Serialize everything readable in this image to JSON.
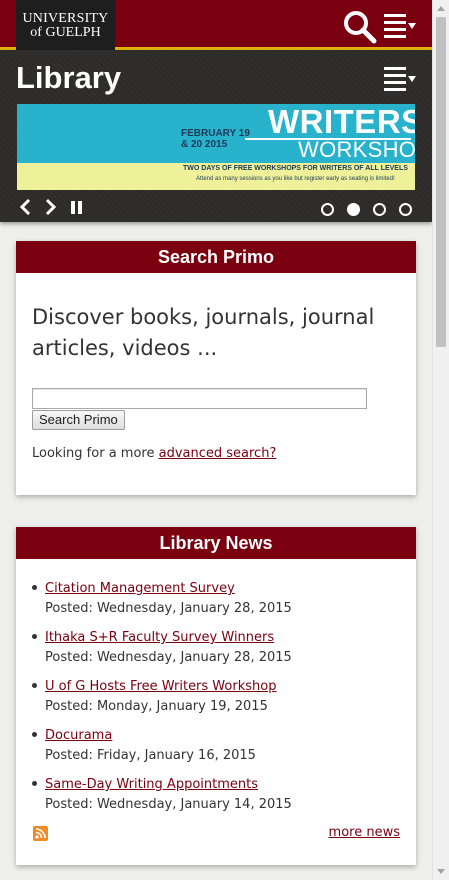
{
  "header": {
    "logo_line1": "UNIVERSITY",
    "logo_line2": "of GUELPH"
  },
  "library": {
    "title": "Library"
  },
  "banner": {
    "date": "FEBRUARY 19 & 20 2015",
    "title_line1": "WRITERS",
    "title_line2": "WORKSHOP",
    "tagline": "TWO DAYS OF FREE WORKSHOPS FOR WRITERS OF ALL LEVELS",
    "subtagline": "Attend as many sessions as you like but register early as seating is limited!",
    "active_slide": 2,
    "slide_count": 4
  },
  "search": {
    "heading": "Search Primo",
    "intro": "Discover books, journals, journal articles, videos ...",
    "input_value": "",
    "button_label": "Search Primo",
    "advanced_prefix": "Looking for a more",
    "advanced_link": "advanced search?"
  },
  "news": {
    "heading": "Library News",
    "items": [
      {
        "title": "Citation Management Survey",
        "posted": "Posted: Wednesday, January 28, 2015"
      },
      {
        "title": "Ithaka S+R Faculty Survey Winners",
        "posted": "Posted: Wednesday, January 28, 2015"
      },
      {
        "title": "U of G Hosts Free Writers Workshop",
        "posted": "Posted: Monday, January 19, 2015"
      },
      {
        "title": "Docurama",
        "posted": "Posted: Friday, January 16, 2015"
      },
      {
        "title": "Same-Day Writing Appointments",
        "posted": "Posted: Wednesday, January 14, 2015"
      }
    ],
    "more_link": "more news"
  },
  "colors": {
    "brand_red": "#7a0010",
    "accent_gold": "#e2b50a",
    "banner_cyan": "#29b2cc"
  }
}
